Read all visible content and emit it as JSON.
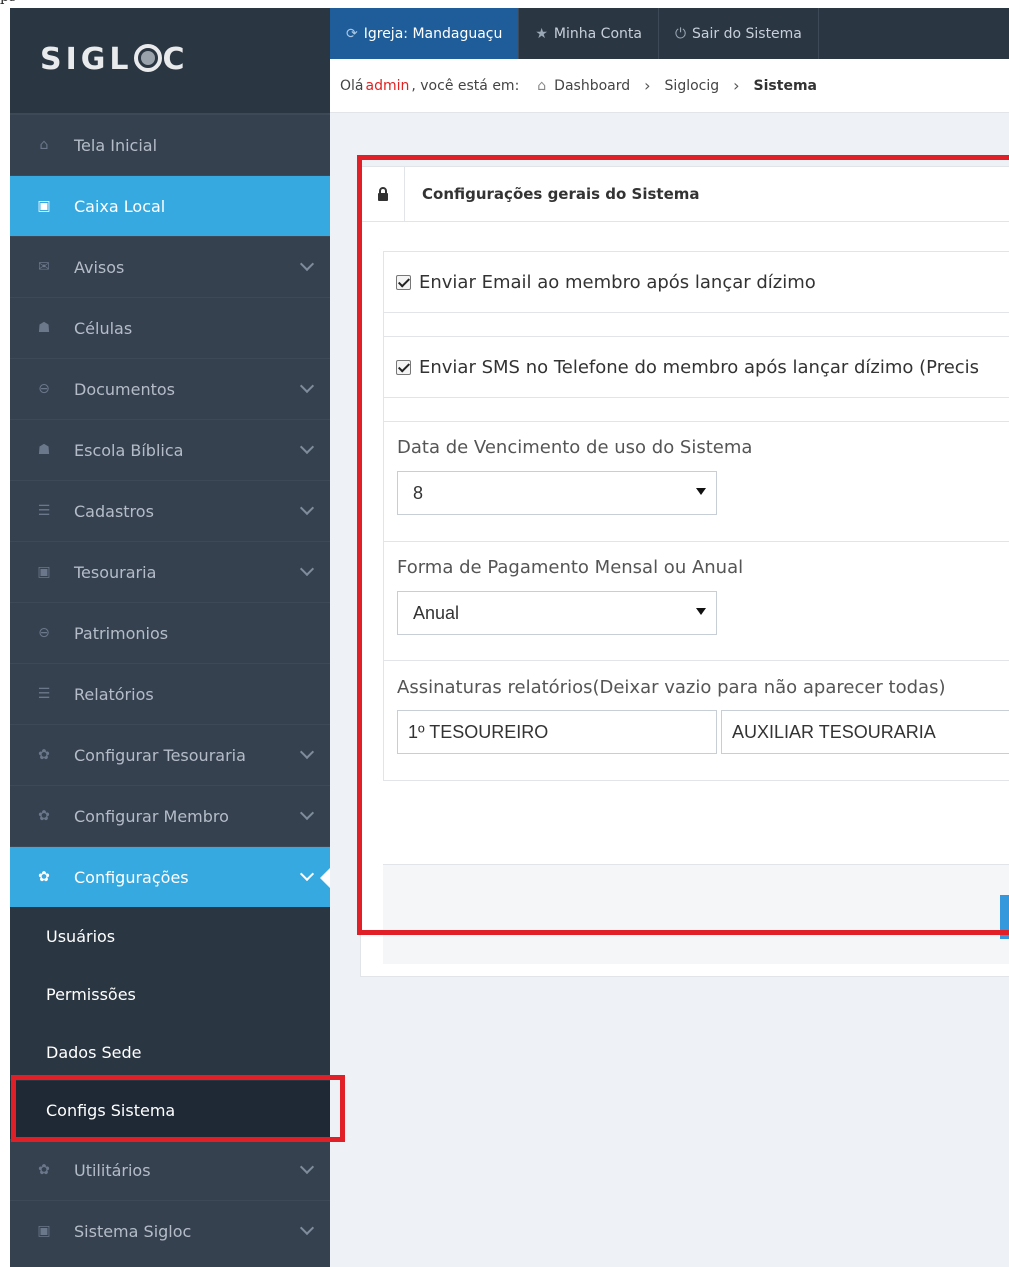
{
  "top_strip": {
    "fragment": "ps"
  },
  "logo": {
    "part1": "SIGL",
    "part2": "C"
  },
  "sidebar": {
    "items": [
      {
        "label": "Tela Inicial",
        "icon": "home-icon",
        "glyph": "⌂"
      },
      {
        "label": "Caixa Local",
        "icon": "money-icon",
        "glyph": "▣"
      },
      {
        "label": "Avisos",
        "icon": "envelope-icon",
        "glyph": "✉"
      },
      {
        "label": "Células",
        "icon": "users-icon",
        "glyph": "☗"
      },
      {
        "label": "Documentos",
        "icon": "drive-icon",
        "glyph": "⊖"
      },
      {
        "label": "Escola Bíblica",
        "icon": "users-icon",
        "glyph": "☗"
      },
      {
        "label": "Cadastros",
        "icon": "list-icon",
        "glyph": "☰"
      },
      {
        "label": "Tesouraria",
        "icon": "money-icon",
        "glyph": "▣"
      },
      {
        "label": "Patrimonios",
        "icon": "drive-icon",
        "glyph": "⊖"
      },
      {
        "label": "Relatórios",
        "icon": "list-icon",
        "glyph": "☰"
      },
      {
        "label": "Configurar Tesouraria",
        "icon": "cog-icon",
        "glyph": "✿"
      },
      {
        "label": "Configurar Membro",
        "icon": "cog-icon",
        "glyph": "✿"
      },
      {
        "label": "Configurações",
        "icon": "cog-icon",
        "glyph": "✿"
      }
    ],
    "submenu": [
      "Usuários",
      "Permissões",
      "Dados Sede",
      "Configs Sistema"
    ],
    "bottom_items": [
      {
        "label": "Utilitários",
        "icon": "cog-icon",
        "glyph": "✿"
      },
      {
        "label": "Sistema Sigloc",
        "icon": "money-icon",
        "glyph": "▣"
      }
    ]
  },
  "topbar": {
    "church_label": "Igreja: Mandaguaçu",
    "account_label": "Minha Conta",
    "logout_label": "Sair do Sistema"
  },
  "breadcrumb": {
    "greeting": "Olá",
    "user": "admin",
    "suffix": ", você está em:",
    "items": [
      "Dashboard",
      "Siglocig",
      "Sistema"
    ]
  },
  "portlet": {
    "title": "Configurações gerais do Sistema",
    "checkbox_email": "Enviar Email ao membro após lançar dízimo",
    "checkbox_sms": "Enviar SMS no Telefone do membro após lançar dízimo (Precis",
    "due_date_label": "Data de Vencimento de uso do Sistema",
    "due_date_value": "8",
    "payment_label": "Forma de Pagamento Mensal ou Anual",
    "payment_value": "Anual",
    "signatures_label": "Assinaturas relatórios(Deixar vazio para não aparecer todas)",
    "signature_1": "1º TESOUREIRO",
    "signature_2": "AUXILIAR TESOURARIA"
  },
  "colors": {
    "sidebar_bg": "#364150",
    "active_blue": "#36a9e1",
    "topbar_active": "#1e5d99",
    "highlight_red": "#e01f26",
    "user_red": "#e02222"
  }
}
